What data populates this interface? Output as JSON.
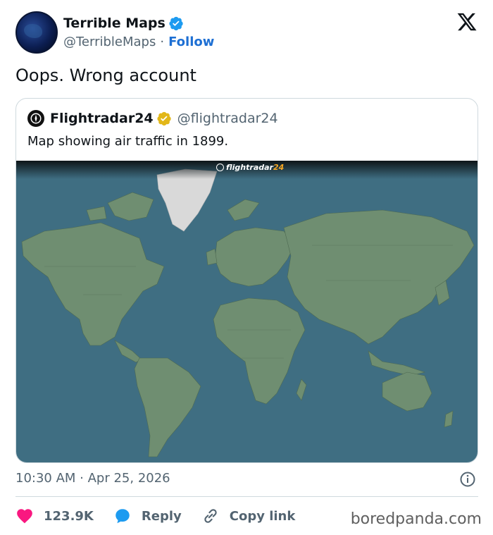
{
  "author": {
    "display_name": "Terrible Maps",
    "handle": "@TerribleMaps",
    "separator": "·",
    "follow_label": "Follow"
  },
  "tweet": {
    "text": "Oops. Wrong account",
    "timestamp": "10:30 AM · Apr 25, 2026"
  },
  "quoted": {
    "display_name": "Flightradar24",
    "handle": "@flightradar24",
    "text": "Map showing air traffic in 1899.",
    "map_logo_text_a": "flightradar",
    "map_logo_text_b": "24"
  },
  "actions": {
    "likes": "123.9K",
    "reply_label": "Reply",
    "copy_link_label": "Copy link"
  },
  "watermark": "boredpanda.com",
  "colors": {
    "accent": "#1d6fd3",
    "like": "#f91880",
    "ocean": "#3f6e82",
    "land": "#6f8e71",
    "ice": "#d9d9d9"
  },
  "icons": {
    "verified": "blue-checkmark",
    "quoted_verified": "gold-checkmark",
    "brand": "x-logo",
    "like": "heart",
    "reply": "speech-bubble",
    "copy": "link",
    "info": "info-circle"
  }
}
